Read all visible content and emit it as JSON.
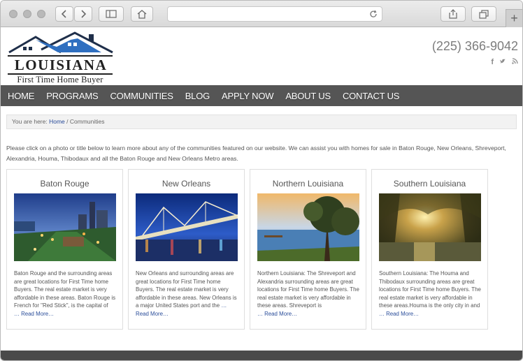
{
  "site": {
    "logo": {
      "main": "LOUISIANA",
      "sub": "First Time Home Buyer"
    },
    "phone": "(225) 366-9042",
    "social_icons": [
      "facebook-icon",
      "twitter-icon",
      "rss-icon"
    ],
    "nav": [
      "HOME",
      "PROGRAMS",
      "COMMUNITIES",
      "BLOG",
      "APPLY NOW",
      "ABOUT US",
      "CONTACT US"
    ],
    "breadcrumb": {
      "prefix": "You are here: ",
      "home": "Home",
      "separator": " / ",
      "current": "Communities"
    },
    "intro": "Please click on a photo or title below to learn more about any of the communities featured on our website. We can assist you with homes for sale in Baton Rouge, New Orleans, Shreveport, Alexandria, Houma, Thibodaux and all the Baton Rouge and New Orleans Metro areas.",
    "cards": [
      {
        "title": "Baton Rouge",
        "text": "Baton Rouge and the surrounding areas are great locations for First Time home Buyers. The real estate market is very affordable in these areas. Baton Rouge is French for \"Red Stick\", is the capital of",
        "more": "… Read More…"
      },
      {
        "title": "New Orleans",
        "text": "New Orleans and surrounding areas are great locations for First Time home Buyers. The real estate market is very affordable in these areas. New Orleans is a major United States port and the",
        "more": "… Read More…"
      },
      {
        "title": "Northern Louisiana",
        "text": "Northern Louisiana: The Shreveport and Alexandria surrounding areas are great locations for First Time home Buyers. The real estate market is very affordable in these areas. Shreveport is",
        "more": "… Read More…"
      },
      {
        "title": "Southern Louisiana",
        "text": "Southern Louisiana: The Houma and Thibodaux surrounding areas are great locations for First Time home Buyers. The real estate market is very affordable in these areas.Houma is the only city in and",
        "more": "… Read More…"
      }
    ]
  },
  "colors": {
    "nav_bg": "#555555",
    "link": "#2a4d9a",
    "phone": "#7d7d7d",
    "logo_roof": "#2f6fc0"
  }
}
